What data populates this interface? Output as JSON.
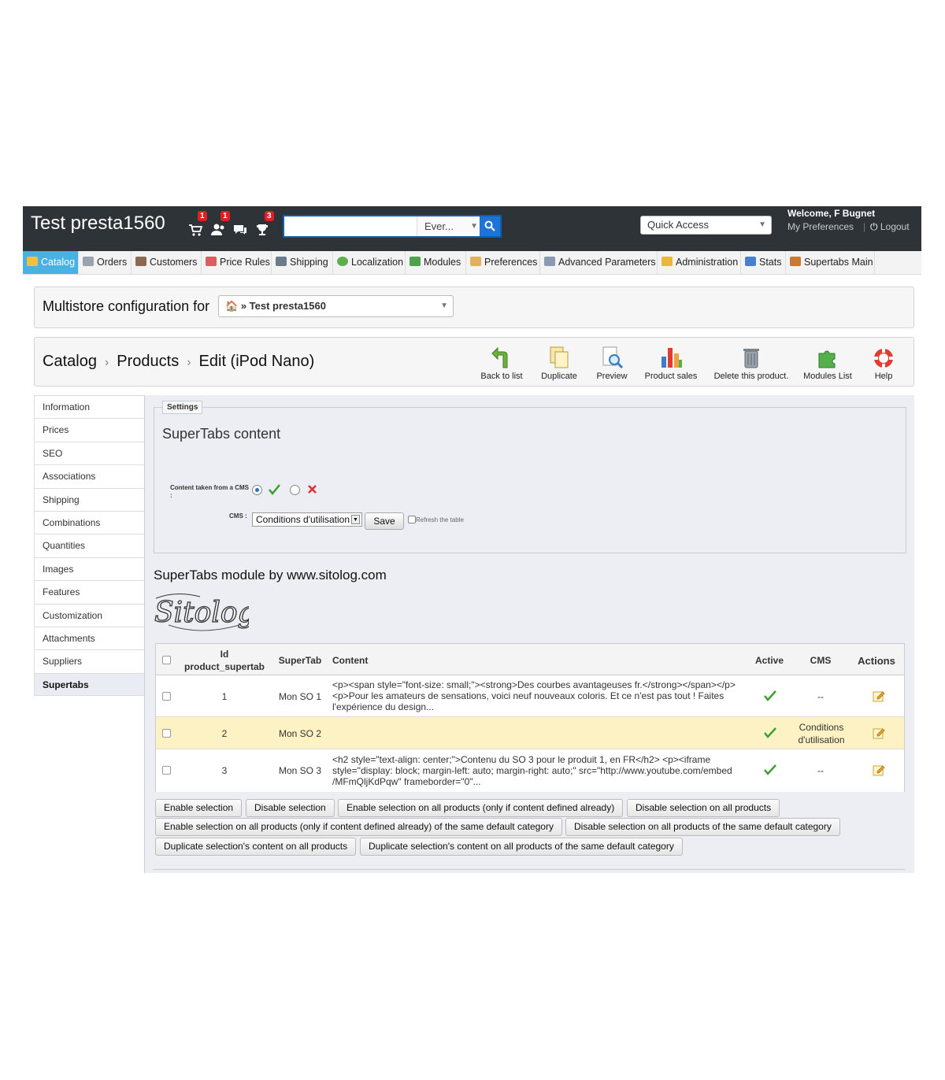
{
  "header": {
    "shop_title": "Test presta1560",
    "notifications": [
      {
        "icon": "cart-icon",
        "count": "1"
      },
      {
        "icon": "customers-icon",
        "count": "1"
      },
      {
        "icon": "messages-icon",
        "count": ""
      },
      {
        "icon": "trophy-icon",
        "count": "3"
      }
    ],
    "search_type": "Ever...",
    "quick_access": "Quick Access",
    "welcome": "Welcome, F Bugnet",
    "my_preferences": "My Preferences",
    "logout": "Logout"
  },
  "menu": [
    {
      "label": "Catalog",
      "color": "#f0c040"
    },
    {
      "label": "Orders",
      "color": "#9aa3ad"
    },
    {
      "label": "Customers",
      "color": "#8a6a52"
    },
    {
      "label": "Price Rules",
      "color": "#d85f5f"
    },
    {
      "label": "Shipping",
      "color": "#6b7b8c"
    },
    {
      "label": "Localization",
      "color": "#5fae4e"
    },
    {
      "label": "Modules",
      "color": "#4ea24e"
    },
    {
      "label": "Preferences",
      "color": "#e0b060"
    },
    {
      "label": "Advanced Parameters",
      "color": "#8a9bb0"
    },
    {
      "label": "Administration",
      "color": "#e8b83a"
    },
    {
      "label": "Stats",
      "color": "#4a7fd0"
    },
    {
      "label": "Supertabs Main",
      "color": "#c87a30"
    }
  ],
  "multistore": {
    "label": "Multistore configuration for",
    "selected": "» Test presta1560"
  },
  "breadcrumb": [
    "Catalog",
    "Products",
    "Edit (iPod Nano)"
  ],
  "toolbar": [
    "Back to list",
    "Duplicate",
    "Preview",
    "Product sales",
    "Delete this product.",
    "Modules List",
    "Help"
  ],
  "tabs": [
    "Information",
    "Prices",
    "SEO",
    "Associations",
    "Shipping",
    "Combinations",
    "Quantities",
    "Images",
    "Features",
    "Customization",
    "Attachments",
    "Suppliers",
    "Supertabs"
  ],
  "settings": {
    "legend": "Settings",
    "title": "SuperTabs content",
    "cms_question": "Content taken from a CMS :",
    "cms_label": "CMS :",
    "cms_value": "Conditions d'utilisation",
    "save": "Save",
    "refresh": "Refresh the table"
  },
  "module_by": "SuperTabs module by www.sitolog.com",
  "logo_text": "Sitolog",
  "table": {
    "headers": {
      "id": "Id",
      "id2": "product_supertab",
      "supertab": "SuperTab",
      "content": "Content",
      "active": "Active",
      "cms": "CMS",
      "actions": "Actions"
    },
    "rows": [
      {
        "id": "1",
        "supertab": "Mon SO 1",
        "content1": "<p><span style=\"font-size: small;\"><strong>Des courbes avantageuses fr.</strong></span></p>",
        "content2": "<p>Pour les amateurs de sensations, voici neuf nouveaux coloris. Et ce n'est pas tout ! Faites",
        "content3": "l'expérience du design...",
        "cms1": "--",
        "cms2": ""
      },
      {
        "id": "2",
        "supertab": "Mon SO 2",
        "content1": "",
        "content2": "",
        "content3": "",
        "cms1": "Conditions",
        "cms2": "d'utilisation"
      },
      {
        "id": "3",
        "supertab": "Mon SO 3",
        "content1": "<h2 style=\"text-align: center;\">Contenu du SO 3 pour le produit 1, en FR</h2> <p><iframe",
        "content2": "style=\"display: block; margin-left: auto; margin-right: auto;\" src=\"http://www.youtube.com/embed",
        "content3": "/MFmQljKdPqw\" frameborder=\"0\"...",
        "cms1": "--",
        "cms2": ""
      }
    ]
  },
  "bulk_actions": [
    "Enable selection",
    "Disable selection",
    "Enable selection on all products (only if content defined already)",
    "Disable selection on all products",
    "Enable selection on all products (only if content defined already) of the same default category",
    "Disable selection on all products of the same default category",
    "Duplicate selection's content on all products",
    "Duplicate selection's content on all products of the same default category"
  ],
  "colors": {
    "header": "#2e3338",
    "active_tab": "#49b2e5",
    "highlight_row": "#fcf2c4",
    "accent": "#1d74d6"
  }
}
